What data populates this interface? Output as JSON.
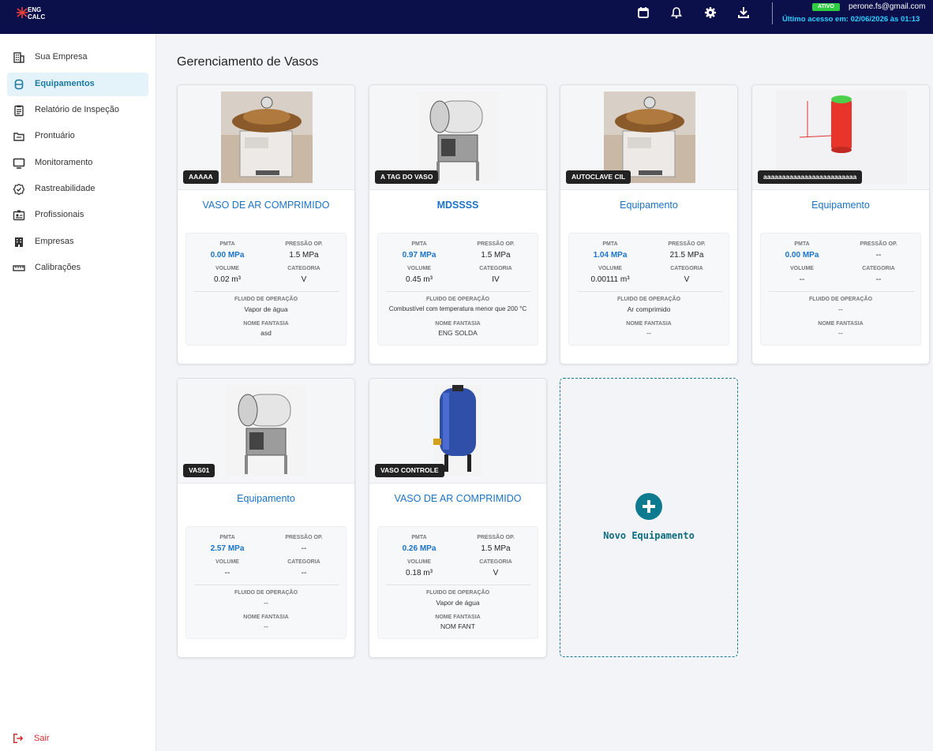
{
  "header": {
    "logo_text": "ENG CALC",
    "status_badge": "ATIVO",
    "user_email": "perone.fs@gmail.com",
    "last_access": "Último acesso em: 02/06/2026 às 01:13",
    "icons": [
      "calendar-icon",
      "bell-icon",
      "gear-icon",
      "download-icon"
    ]
  },
  "sidebar": {
    "items": [
      {
        "label": "Sua Empresa",
        "icon": "building-icon"
      },
      {
        "label": "Equipamentos",
        "icon": "equipment-icon",
        "active": true
      },
      {
        "label": "Relatório de Inspeção",
        "icon": "clipboard-icon"
      },
      {
        "label": "Prontuário",
        "icon": "folder-icon"
      },
      {
        "label": "Monitoramento",
        "icon": "monitor-icon"
      },
      {
        "label": "Rastreabilidade",
        "icon": "badge-check-icon"
      },
      {
        "label": "Profissionais",
        "icon": "id-card-icon"
      },
      {
        "label": "Empresas",
        "icon": "buildings-icon"
      },
      {
        "label": "Calibrações",
        "icon": "ruler-icon"
      }
    ],
    "logout": "Sair"
  },
  "main": {
    "title": "Gerenciamento de Vasos",
    "labels": {
      "pmta": "PMTA",
      "pressao": "PRESSÃO OP.",
      "volume": "VOLUME",
      "categoria": "CATEGORIA",
      "fluido": "FLUIDO DE OPERAÇÃO",
      "fantasia": "NOME FANTASIA"
    },
    "cards": [
      {
        "tag": "AAAAA",
        "name": "VASO DE AR COMPRIMIDO",
        "pmta": "0.00 MPa",
        "pressao": "1.5 MPa",
        "volume": "0.02 m³",
        "categoria": "V",
        "fluido": "Vapor de água",
        "fantasia": "asd",
        "image": "autoclave-vertical"
      },
      {
        "tag": "A TAG DO VASO",
        "name": "MDSSSS",
        "pmta": "0.97 MPa",
        "pressao": "1.5 MPa",
        "volume": "0.45 m³",
        "categoria": "IV",
        "fluido": "Combustível com temperatura menor que 200 °C",
        "fantasia": "ENG SOLDA",
        "image": "autoclave-horizontal"
      },
      {
        "tag": "AUTOCLAVE CIL",
        "name": "Equipamento",
        "pmta": "1.04 MPa",
        "pressao": "21.5 MPa",
        "volume": "0.00111 m³",
        "categoria": "V",
        "fluido": "Ar comprimido",
        "fantasia": "--",
        "image": "autoclave-vertical"
      },
      {
        "tag": "aaaaaaaaaaaaaaaaaaaaaaaaa",
        "name": "Equipamento",
        "pmta": "0.00 MPa",
        "pressao": "--",
        "volume": "--",
        "categoria": "--",
        "fluido": "--",
        "fantasia": "--",
        "image": "cylinder-3d"
      },
      {
        "tag": "VAS01",
        "name": "Equipamento",
        "pmta": "2.57 MPa",
        "pressao": "--",
        "volume": "--",
        "categoria": "--",
        "fluido": "--",
        "fantasia": "--",
        "image": "autoclave-horizontal"
      },
      {
        "tag": "VASO CONTROLE",
        "name": "VASO DE AR COMPRIMIDO",
        "pmta": "0.26 MPa",
        "pressao": "1.5 MPa",
        "volume": "0.18 m³",
        "categoria": "V",
        "fluido": "Vapor de água",
        "fantasia": "NOM FANT",
        "image": "blue-tank"
      }
    ],
    "new_card_label": "Novo Equipamento"
  }
}
